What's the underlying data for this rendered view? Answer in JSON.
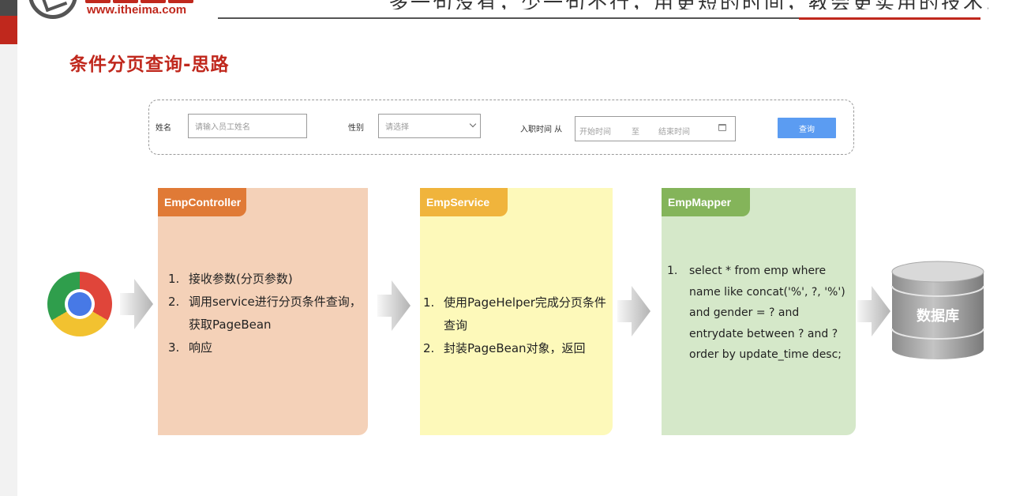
{
  "header": {
    "logo_url": "www.itheima.com",
    "slogan": "多一句没有，少一句不行，用更短的时间，教会更实用的技术!"
  },
  "page_title": "条件分页查询-思路",
  "search_form": {
    "name_label": "姓名",
    "name_placeholder": "请输入员工姓名",
    "gender_label": "性别",
    "gender_placeholder": "请选择",
    "date_label": "入职时间 从",
    "date_start_placeholder": "开始时间",
    "date_separator": "至",
    "date_end_placeholder": "结束时间",
    "query_button": "查询"
  },
  "browser_icon": "chrome-icon",
  "controller": {
    "title": "EmpController",
    "items": [
      {
        "num": "1.",
        "text": "接收参数(分页参数)"
      },
      {
        "num": "2.",
        "text": "调用service进行分页条件查询，获取PageBean"
      },
      {
        "num": "3.",
        "text": "响应"
      }
    ]
  },
  "service": {
    "title": "EmpService",
    "items": [
      {
        "num": "1.",
        "text": "使用PageHelper完成分页条件查询"
      },
      {
        "num": "2.",
        "text": "封装PageBean对象，返回"
      }
    ]
  },
  "mapper": {
    "title": "EmpMapper",
    "items": [
      {
        "num": "1.",
        "text": "select * from emp where name like concat('%', ?, '%') and gender = ? and entrydate between ? and ?  order by update_time desc;"
      }
    ]
  },
  "database": {
    "label": "数据库"
  },
  "colors": {
    "brand_red": "#c0281d",
    "controller_bg": "#f4d1b8",
    "controller_tab": "#e07a36",
    "service_bg": "#fdf9ba",
    "service_tab": "#f0b43c",
    "mapper_bg": "#d5e8c9",
    "mapper_tab": "#84b45a",
    "query_button": "#5b9cf2"
  }
}
